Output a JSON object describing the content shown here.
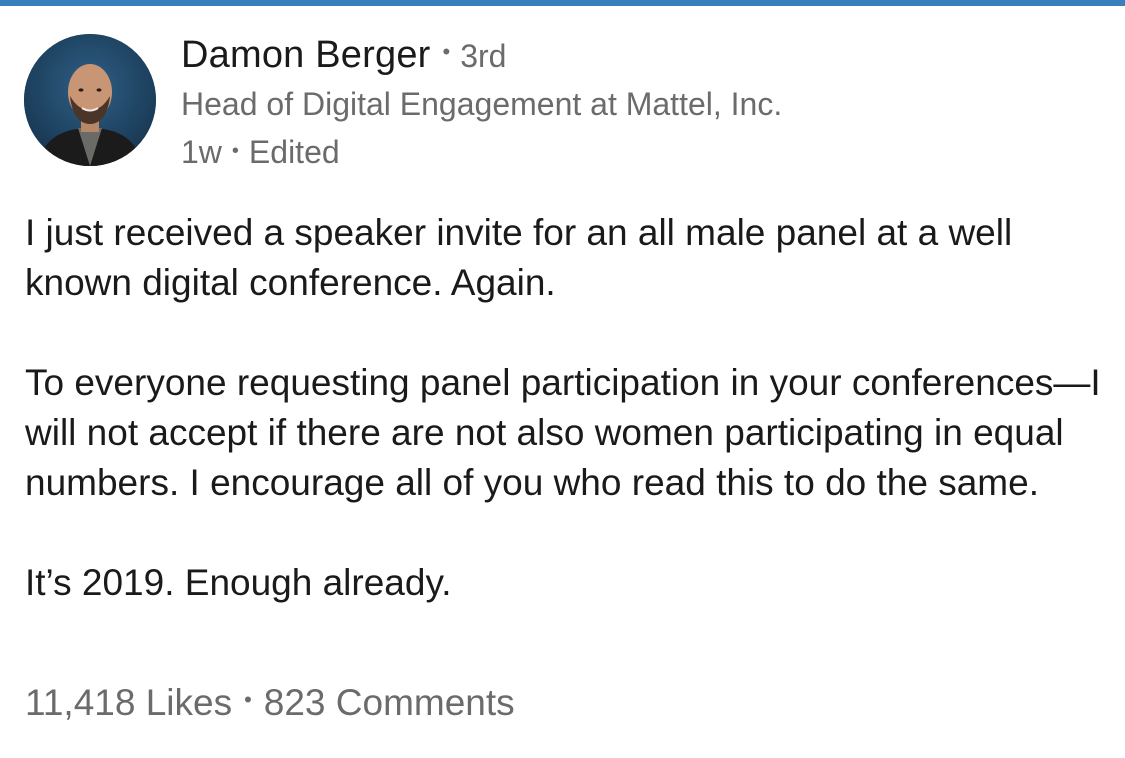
{
  "author": {
    "name": "Damon Berger",
    "degree": "3rd",
    "headline": "Head of Digital Engagement at Mattel, Inc.",
    "time": "1w",
    "edited": "Edited",
    "separator": "•"
  },
  "post": {
    "paragraphs": [
      "I just received a speaker invite for an all male panel at a well known digital conference. Again.",
      "To everyone requesting panel participation in your conferences—I will not accept if there are not also women participating in equal numbers. I encourage all of you who read this to do the same.",
      "It’s 2019. Enough already."
    ]
  },
  "stats": {
    "likes": "11,418 Likes",
    "comments": "823 Comments",
    "separator": "•"
  },
  "colors": {
    "accent": "#3a7fbd",
    "text": "#1a1a1a",
    "muted": "#6b6b6b"
  }
}
